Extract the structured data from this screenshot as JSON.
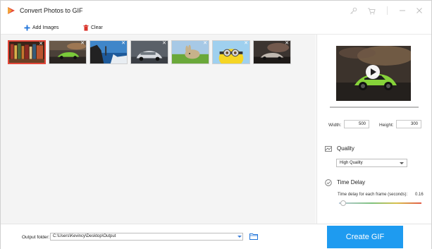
{
  "window": {
    "title": "Convert Photos to GIF",
    "icons": [
      "key-icon",
      "cart-icon",
      "minimize-icon",
      "close-icon"
    ]
  },
  "toolbar": {
    "add_images_label": "Add Images",
    "clear_label": "Clear"
  },
  "thumbnails": [
    {
      "subject": "bookshelf",
      "selected": true
    },
    {
      "subject": "car-sunset",
      "selected": false
    },
    {
      "subject": "cliff-sea",
      "selected": false
    },
    {
      "subject": "silver-car",
      "selected": false
    },
    {
      "subject": "rabbit-grass",
      "selected": false
    },
    {
      "subject": "cartoon-minion",
      "selected": false
    },
    {
      "subject": "car-dark",
      "selected": false
    }
  ],
  "preview": {
    "progress_fraction": 1.0
  },
  "dimensions": {
    "width_label": "Width:",
    "width_value": "500",
    "height_label": "Height:",
    "height_value": "300"
  },
  "quality": {
    "title": "Quality",
    "selected": "High Quality"
  },
  "time_delay": {
    "title": "Time Delay",
    "description": "Time delay for each frame (seconds):",
    "value": "0.16",
    "slider_fraction": 0.05
  },
  "output": {
    "label": "Output folder:",
    "path": "C:\\Users\\Kevincy\\Desktop\\Output"
  },
  "create_button": "Create GIF",
  "colors": {
    "accent_blue": "#1e9bf0",
    "selection_red": "#e4473a",
    "clear_red": "#d9342b"
  }
}
